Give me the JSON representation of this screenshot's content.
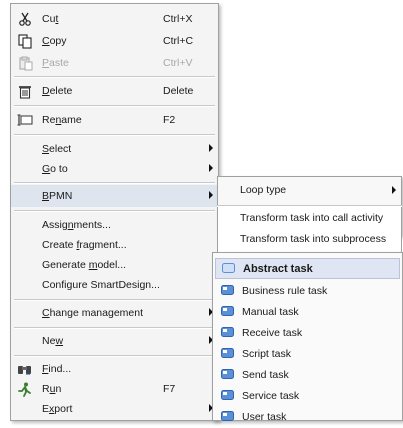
{
  "main_menu": {
    "cut": {
      "pre": "Cu",
      "ul": "t",
      "post": "",
      "shortcut": "Ctrl+X"
    },
    "copy": {
      "pre": "",
      "ul": "C",
      "post": "opy",
      "shortcut": "Ctrl+C"
    },
    "paste": {
      "pre": "",
      "ul": "P",
      "post": "aste",
      "shortcut": "Ctrl+V"
    },
    "delete": {
      "pre": "",
      "ul": "D",
      "post": "elete",
      "shortcut": "Delete"
    },
    "rename": {
      "pre": "Re",
      "ul": "n",
      "post": "ame",
      "shortcut": "F2"
    },
    "select": {
      "pre": "",
      "ul": "S",
      "post": "elect"
    },
    "goto": {
      "pre": "",
      "ul": "G",
      "post": "o to"
    },
    "bpmn": {
      "pre": "",
      "ul": "B",
      "post": "PMN"
    },
    "assignments": {
      "pre": "Assig",
      "ul": "n",
      "post": "ments..."
    },
    "create_fragment": {
      "pre": "Create ",
      "ul": "f",
      "post": "ragment..."
    },
    "generate_model": {
      "pre": "Generate ",
      "ul": "m",
      "post": "odel..."
    },
    "configure_smartdesign": {
      "label": "Configure SmartDesign..."
    },
    "change_management": {
      "pre": "",
      "ul": "C",
      "post": "hange management"
    },
    "new": {
      "pre": "Ne",
      "ul": "w",
      "post": ""
    },
    "find": {
      "pre": "",
      "ul": "F",
      "post": "ind..."
    },
    "run": {
      "pre": "R",
      "ul": "u",
      "post": "n",
      "shortcut": "F7"
    },
    "export": {
      "pre": "E",
      "ul": "x",
      "post": "port"
    }
  },
  "bpmn_submenu": {
    "loop_type": "Loop type",
    "transform_call_activity": "Transform task into call activity",
    "transform_subprocess": "Transform task into subprocess"
  },
  "task_submenu": {
    "items": [
      "Abstract task",
      "Business rule task",
      "Manual task",
      "Receive task",
      "Script task",
      "Send task",
      "Service task",
      "User task"
    ]
  },
  "colors": {
    "highlight": "#dfe5ef",
    "task_icon_blue": "#5b8fd6",
    "disabled_text": "#a8a8a8"
  }
}
